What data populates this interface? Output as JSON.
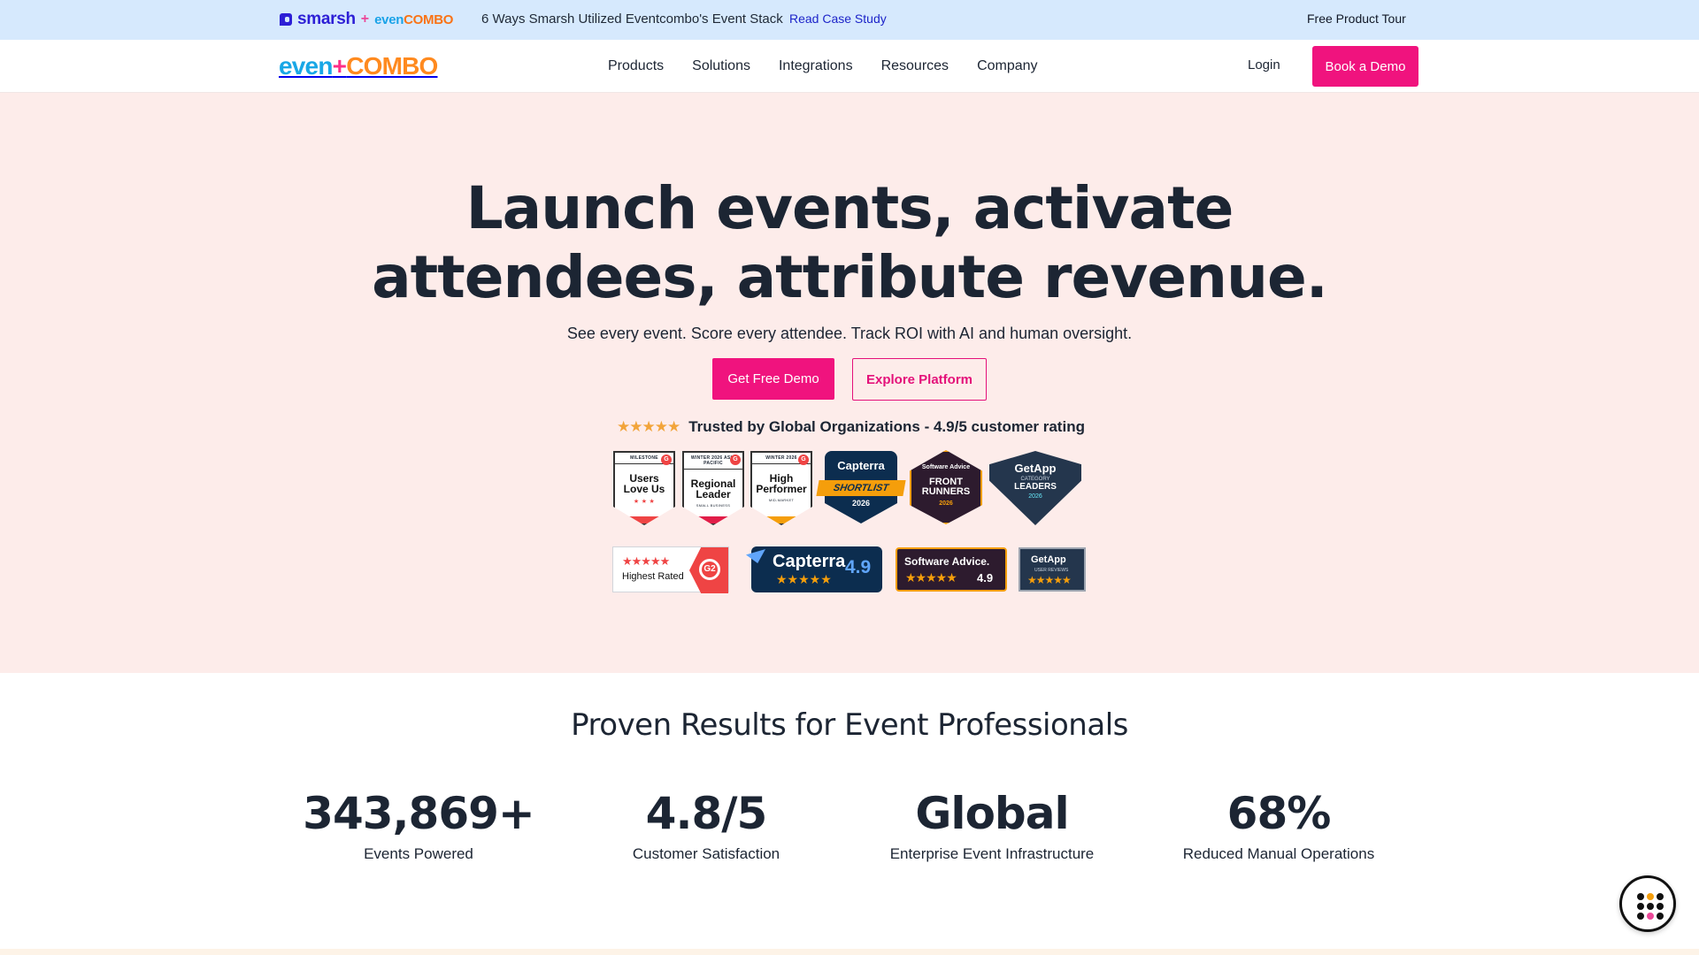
{
  "announcement": {
    "logo_left": "smarsh",
    "logo_plus": "+",
    "logo_right_part1": "even",
    "logo_right_part2": "COMBO",
    "case_text": "6 Ways Smarsh Utilized Eventcombo's Event Stack",
    "case_link": "Read Case Study",
    "tour_link": "Free Product Tour"
  },
  "nav": {
    "brand_part1": "even",
    "brand_part2": "+",
    "brand_part3": "COMBO",
    "menu": [
      "Products",
      "Solutions",
      "Integrations",
      "Resources",
      "Company"
    ],
    "login": "Login",
    "book_demo": "Book a Demo"
  },
  "hero": {
    "headline_line1": "Launch events, activate",
    "headline_line2": "attendees, attribute revenue.",
    "subheadline": "See every event. Score every attendee. Track ROI with AI and human oversight.",
    "cta_primary": "Get Free Demo",
    "cta_secondary": "Explore Platform",
    "rating_stars": "★★★★★",
    "trust_text": "Trusted by Global Organizations - 4.9/5 customer rating"
  },
  "badges_row1": [
    {
      "top": "MILESTONE",
      "title_line1": "Users",
      "title_line2": "Love Us",
      "tiny": "★ ★ ★"
    },
    {
      "top": "WINTER 2026 ASIA PACIFIC",
      "title_line1": "Regional",
      "title_line2": "Leader",
      "tiny": "SMALL BUSINESS"
    },
    {
      "top": "WINTER 2026",
      "title_line1": "High",
      "title_line2": "Performer",
      "tiny": "MID-MARKET"
    }
  ],
  "badge_capterra": {
    "brand": "Capterra",
    "ribbon": "SHORTLIST",
    "year": "2026"
  },
  "badge_software_advice": {
    "brand": "Software Advice",
    "line1": "FRONT",
    "line2": "RUNNERS",
    "year": "2026"
  },
  "badge_getapp": {
    "brand": "GetApp",
    "sub": "CATEGORY",
    "main": "LEADERS",
    "year": "2026"
  },
  "badges_row2": {
    "g2": {
      "stars": "★★★★★",
      "label": "Highest Rated",
      "logo": "G2"
    },
    "capterra": {
      "brand": "Capterra",
      "stars": "★★★★★",
      "score": "4.9"
    },
    "software_advice": {
      "brand": "Software Advice.",
      "stars": "★★★★★",
      "score": "4.9"
    },
    "getapp": {
      "brand": "GetApp",
      "sub": "USER REVIEWS",
      "stars": "★★★★★"
    }
  },
  "results": {
    "title": "Proven Results for Event Professionals",
    "stats": [
      {
        "value": "343,869+",
        "label": "Events Powered"
      },
      {
        "value": "4.8/5",
        "label": "Customer Satisfaction"
      },
      {
        "value": "Global",
        "label": "Enterprise Event Infrastructure"
      },
      {
        "value": "68%",
        "label": "Reduced Manual Operations"
      }
    ]
  },
  "colors": {
    "brand_pink": "#f0137e",
    "hero_bg": "#fdecea",
    "announce_bg": "#d6e9fd",
    "text_dark": "#1c2533"
  }
}
